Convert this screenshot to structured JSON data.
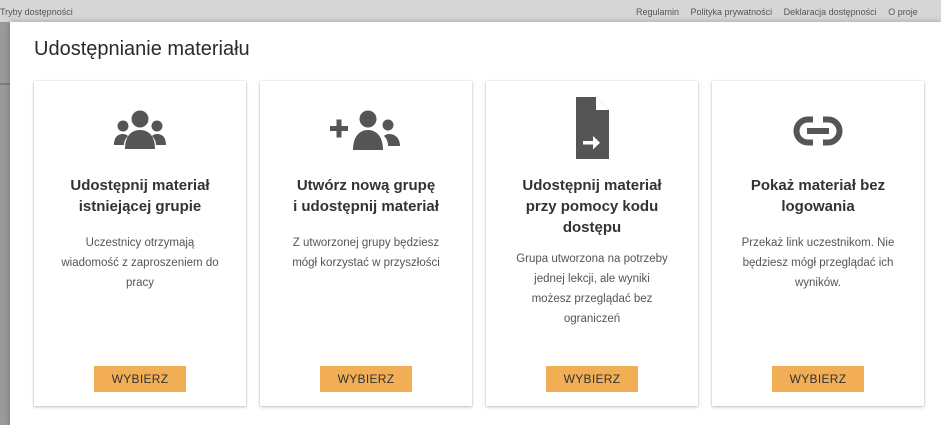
{
  "topbar": {
    "accessibility_modes": "Tryby dostępności",
    "links": [
      "Regulamin",
      "Polityka prywatności",
      "Deklaracja dostępności",
      "O proje"
    ]
  },
  "modal": {
    "title": "Udostępnianie materiału",
    "cards": [
      {
        "icon": "users-group-icon",
        "title_lines": [
          "Udostępnij materiał",
          "istniejącej grupie"
        ],
        "desc_lines": [
          "Uczestnicy otrzymają",
          "wiadomość z zaproszeniem do",
          "pracy"
        ],
        "button": "WYBIERZ"
      },
      {
        "icon": "add-group-icon",
        "title_lines": [
          "Utwórz nową grupę",
          "i udostępnij materiał"
        ],
        "desc_lines": [
          "Z utworzonej grupy będziesz",
          "mógł korzystać w przyszłości"
        ],
        "button": "WYBIERZ"
      },
      {
        "icon": "file-share-icon",
        "title_lines": [
          "Udostępnij materiał",
          "przy pomocy kodu",
          "dostępu"
        ],
        "desc_lines": [
          "Grupa utworzona na potrzeby",
          "jednej lekcji, ale wyniki",
          "możesz przeglądać bez",
          "ograniczeń"
        ],
        "button": "WYBIERZ"
      },
      {
        "icon": "link-icon",
        "title_lines": [
          "Pokaż materiał bez",
          "logowania"
        ],
        "desc_lines": [
          "Przekaż link uczestnikom. Nie",
          "będziesz mógł przeglądać ich",
          "wyników."
        ],
        "button": "WYBIERZ"
      }
    ]
  }
}
